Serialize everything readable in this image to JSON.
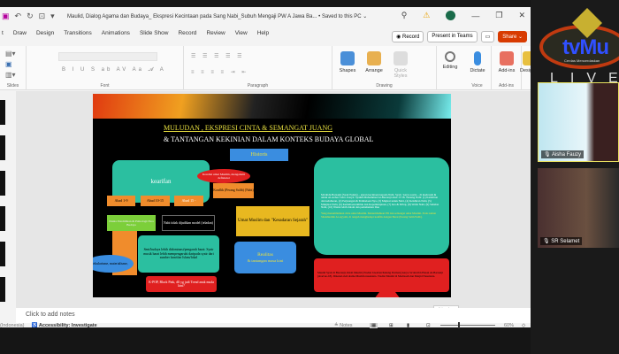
{
  "app": {
    "title": "Maulid, Dialog Agama dan Budaya_ Ekspresi Kecintaan pada Sang Nabi_Subuh Mengaji PW A Jawa Ba... • Saved to this PC ⌄"
  },
  "tabs": [
    "t",
    "Draw",
    "Design",
    "Transitions",
    "Animations",
    "Slide Show",
    "Record",
    "Review",
    "View",
    "Help"
  ],
  "tab_buttons": {
    "record": "◉ Record",
    "teams": "Present in Teams",
    "share": "Share ⌄"
  },
  "ribbon": {
    "groups": {
      "slides": "Slides",
      "font": "Font",
      "paragraph": "Paragraph",
      "drawing": "Drawing",
      "voice": "Voice",
      "addins": "Add-ins"
    },
    "buttons": {
      "shapes": "Shapes",
      "arrange": "Arrange",
      "quick_styles": "Quick Styles",
      "editing": "Editing",
      "dictate": "Dictate",
      "addins": "Add-ins",
      "designer": "Designer"
    }
  },
  "slide": {
    "title1": "MULUDAN , EKSPRESI CINTA & SEMANGAT JUANG",
    "title2": "& TANTANGAN KEKINIAN DALAM KONTEKS BUDAYA GLOBAL",
    "historis": "Historis",
    "kearifan": "kearifan",
    "abad1": "Abad 1-9",
    "abad2": "Abad 10-15",
    "abad3": "Abad 15 -",
    "kondisi": "Kondisi umat Muslim, mengalami defisiensi",
    "konflik": "Konflik (Perang Salib) (Nabi)",
    "umat": "Umat Muslim dan \"Kesadaran Sejarah\"",
    "realitas": "Realitas",
    "tantangan": "& tantangan masa kini",
    "dunia": "Dunia Pendidikan & Psikologi/Jiwa Budaya",
    "nabi_model": "Nabi tidak dijadikan model (teladan)",
    "seni": "Seni/budaya lebih didominasi/pengaruh barat: Syair musik barat lebih mempengaruhi daripada syair dari sumber kearifan Islam/lokal",
    "sekular": "Sekularisme, materialisme,",
    "kpop": "K-POP, Black Pink, dll yg jadi Trend anak muda kini?",
    "right_text": "Ma'ulidu Barzanji (Syair Pujian) – ajaran kecintaan kepada Nabi. Syair / karya sastra – di madrasah & untuk Al-Azhar Cairo. Karya: Syaikh Muhammad Al-Barzanji abad 17/18. Tentang Nabi: (1) Kelahiran dan keluhuran, (2) Perjuangan & Pembelaan Nya, (3) Mujizat untuk Nabi, (4) Kelahiran Nabi, (5) Mukjizat Nabi, (6) Kemuliaan/akhlak dan Kepemimpinan, (7) Isra & Mi'raj, (8) Wafat Nabi, (9) Sahabat Nabi, (10) Wasiat lebih dalam dan pemahaman Dua",
    "right_yellow": "Yang menumbuhkan cinta umat Muslim. Menumbuhkan PD dan semangat umat Muslim. Pada zaman Shalahuddin Al-Ayyubi, di tengah menghadapi konflik dengan Barat (Perang Salib/Salib).",
    "red_text": "Maulid Syair di Barzanji, Kitab Maulid (Tradisi Jawaban/Kalung Permata) karya Sa'dan Ibn Hasan Al-Barzanji (abad ke-18). Dikenal oleh ulama Muslim nusantara. Tradisi Maulid di Madrasah dan Masjid Nusantara."
  },
  "notes": {
    "placeholder": "Click to add notes",
    "tooltip": "Slide Show"
  },
  "status": {
    "lang": "(Indonesia)",
    "accessibility": "Accessibility: Investigate",
    "notes": "Notes",
    "zoom": "60%",
    "zoom_level": 0.6
  },
  "right_panel": {
    "logo": "tvMu",
    "logo_sub": "Cerdas Mencerdaskan",
    "live": "LIVE",
    "participants": [
      "Aisha Fauzy",
      "SR Selamet"
    ]
  },
  "colors": {
    "teal": "#2bbfa0",
    "orange": "#f08c2c",
    "red": "#e02020",
    "blue": "#3a8de0",
    "gold": "#e8b820",
    "share": "#d83b01"
  }
}
